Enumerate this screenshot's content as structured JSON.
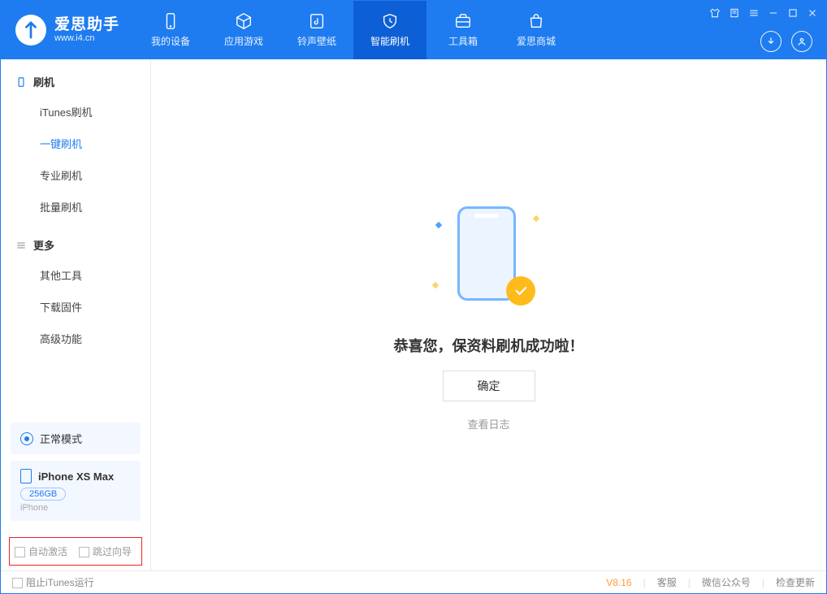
{
  "app": {
    "name": "爱思助手",
    "url": "www.i4.cn"
  },
  "nav": [
    {
      "label": "我的设备",
      "icon": "device"
    },
    {
      "label": "应用游戏",
      "icon": "cube"
    },
    {
      "label": "铃声壁纸",
      "icon": "music"
    },
    {
      "label": "智能刷机",
      "icon": "shield",
      "active": true
    },
    {
      "label": "工具箱",
      "icon": "briefcase"
    },
    {
      "label": "爱思商城",
      "icon": "bag"
    }
  ],
  "sidebar": {
    "group1": {
      "title": "刷机",
      "items": [
        {
          "label": "iTunes刷机"
        },
        {
          "label": "一键刷机",
          "active": true
        },
        {
          "label": "专业刷机"
        },
        {
          "label": "批量刷机"
        }
      ]
    },
    "group2": {
      "title": "更多",
      "items": [
        {
          "label": "其他工具"
        },
        {
          "label": "下载固件"
        },
        {
          "label": "高级功能"
        }
      ]
    }
  },
  "device_panel": {
    "mode": "正常模式",
    "name": "iPhone XS Max",
    "storage": "256GB",
    "type": "iPhone"
  },
  "options": {
    "auto_activate": "自动激活",
    "skip_wizard": "跳过向导"
  },
  "main": {
    "message": "恭喜您，保资料刷机成功啦！",
    "confirm": "确定",
    "view_log": "查看日志"
  },
  "status": {
    "block_itunes": "阻止iTunes运行",
    "version": "V8.16",
    "links": [
      "客服",
      "微信公众号",
      "检查更新"
    ]
  }
}
